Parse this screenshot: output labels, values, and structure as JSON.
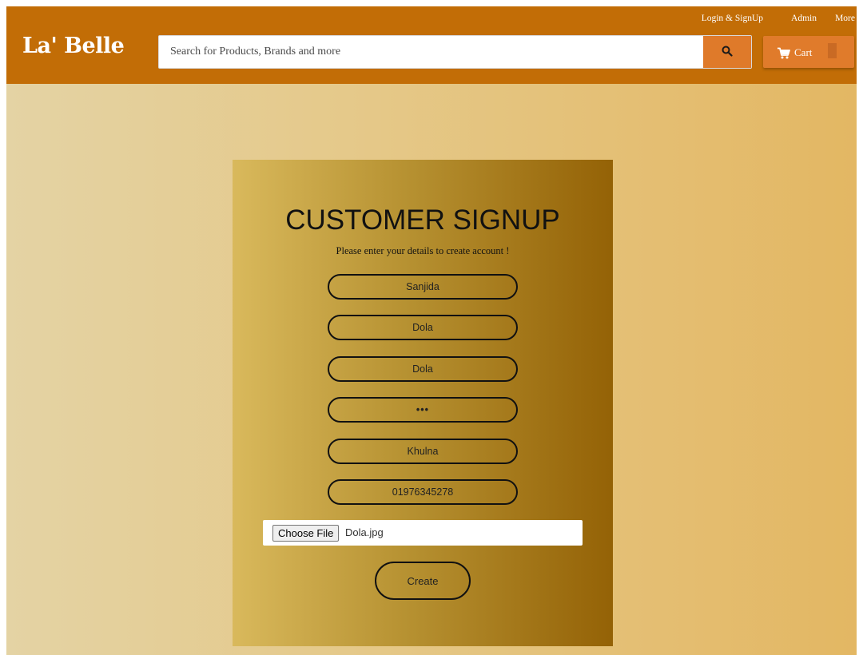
{
  "header": {
    "logo": "La' Belle",
    "nav": [
      "Login & SignUp",
      "Admin",
      "More"
    ],
    "search_placeholder": "Search for Products, Brands and more",
    "cart_label": "Cart",
    "search_icon": "search-icon",
    "cart_icon": "cart-icon"
  },
  "form": {
    "title": "CUSTOMER SIGNUP",
    "subtitle": "Please enter your details to create account !",
    "fields": {
      "first_name": "Sanjida",
      "last_name": "Dola",
      "username": "Dola",
      "password": "•••",
      "address": "Khulna",
      "phone": "01976345278"
    },
    "file_button": "Choose File",
    "file_name": "Dola.jpg",
    "submit_label": "Create"
  },
  "colors": {
    "header": "#c26d06",
    "search_button": "#df7a2a",
    "cart_button": "#e07b2b",
    "card_left": "#d9b95c",
    "card_right": "#946206"
  }
}
